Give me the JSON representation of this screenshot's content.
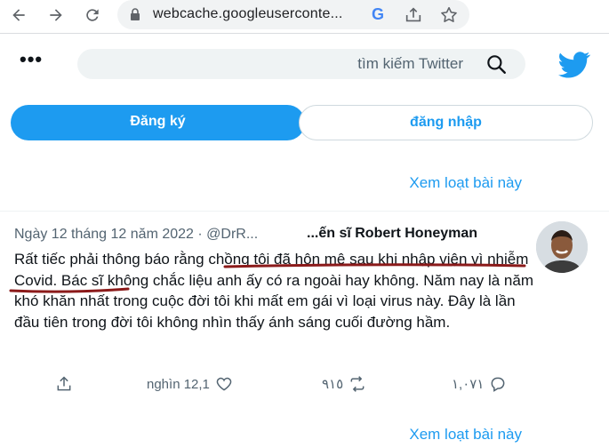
{
  "browser": {
    "url": "webcache.googleuserconte...",
    "icons": [
      "back-icon",
      "forward-icon",
      "reload-icon",
      "lock-icon",
      "google-icon",
      "share-icon",
      "star-icon"
    ]
  },
  "twitter": {
    "more_label": "•••",
    "search_placeholder": "tìm kiếm Twitter",
    "signup_label": "Đăng ký",
    "login_label": "đăng nhập",
    "see_more_top": "Xem loạt bài này",
    "see_more_bottom": "Xem loạt bài này",
    "brand_color": "#1d9bf0"
  },
  "tweet": {
    "meta": "Ngày 12 tháng 12 năm 2022 · @DrR...",
    "author": "...ến sĩ Robert Honeyman",
    "text_part1": "Rất tiếc phải thông báo rằng ",
    "text_highlight": "chồng tôi đã hôn mê sau khi nhập viện vì nhiễm Covid",
    "text_part2": ". Bác sĩ không chắc liệu anh ấy có ra ngoài hay không. Năm nay là năm khó khăn nhất trong cuộc đời tôi khi mất em gái vì loại virus này. Đây là lần đầu tiên trong đời tôi không nhìn thấy ánh sáng cuối đường hầm.",
    "likes": "nghìn 12,1",
    "retweets": "٩١٥",
    "replies": "١,٠٧١",
    "highlight_color": "#8b1a1a"
  }
}
